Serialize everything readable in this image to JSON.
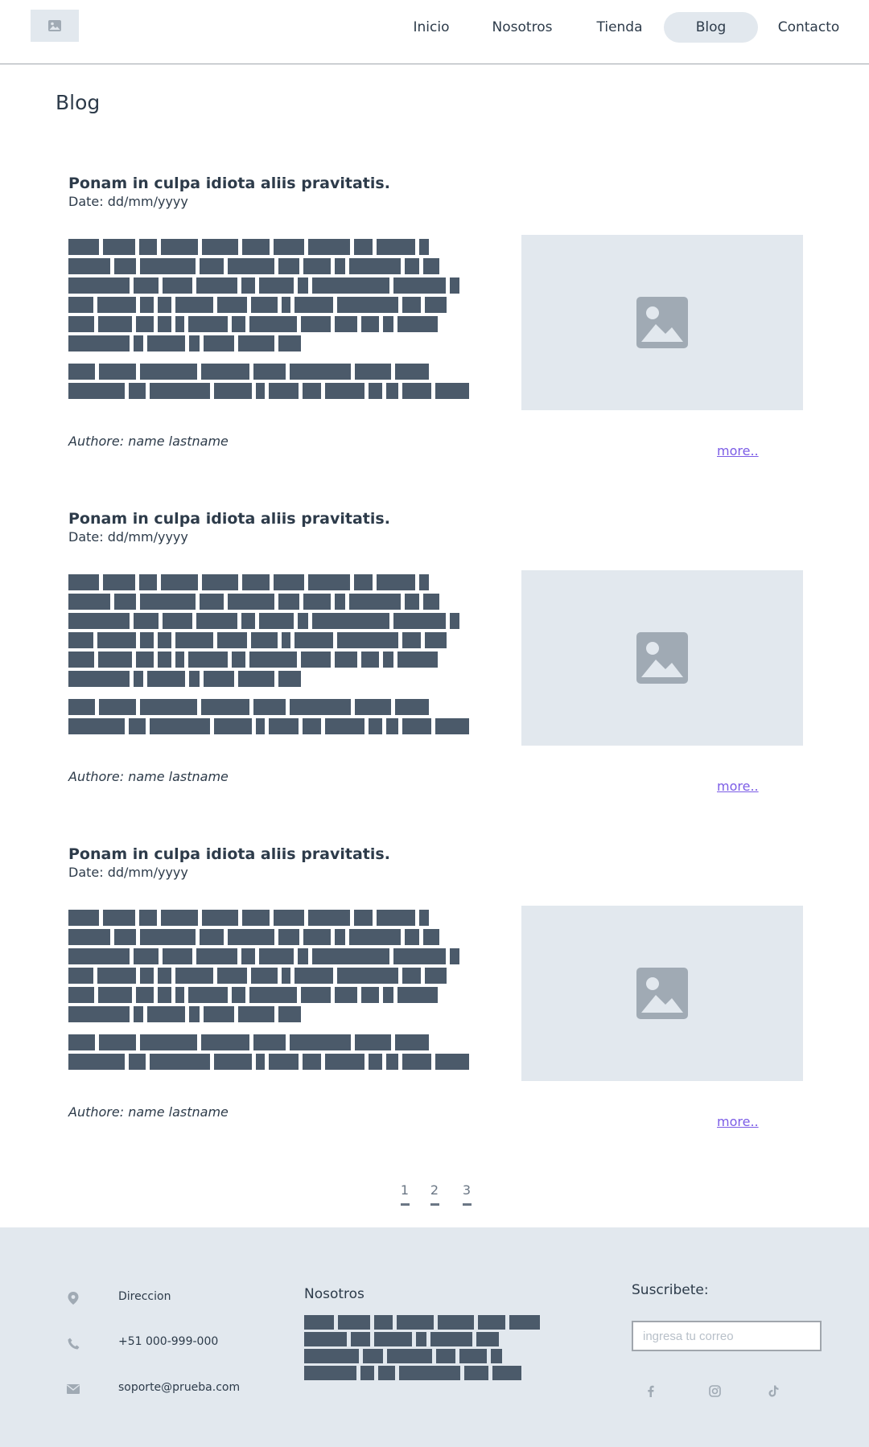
{
  "nav": {
    "items": [
      {
        "label": "Inicio",
        "active": false
      },
      {
        "label": "Nosotros",
        "active": false
      },
      {
        "label": "Tienda",
        "active": false
      },
      {
        "label": "Blog",
        "active": true
      },
      {
        "label": "Contacto",
        "active": false
      }
    ]
  },
  "page": {
    "title": "Blog"
  },
  "posts": [
    {
      "title": "Ponam in culpa idiota aliis pravitatis.",
      "date": "Date: dd/mm/yyyy",
      "author": "Authore: name lastname",
      "more_label": "more.."
    },
    {
      "title": "Ponam in culpa idiota aliis pravitatis.",
      "date": "Date: dd/mm/yyyy",
      "author": "Authore: name lastname",
      "more_label": "more.."
    },
    {
      "title": "Ponam in culpa idiota aliis pravitatis.",
      "date": "Date: dd/mm/yyyy",
      "author": "Authore: name lastname",
      "more_label": "more.."
    }
  ],
  "pagination": {
    "pages": [
      "1",
      "2",
      "3"
    ]
  },
  "footer": {
    "address_label": "Direccion",
    "phone": "+51 000-999-000",
    "email": "soporte@prueba.com",
    "about_heading": "Nosotros",
    "subscribe_heading": "Suscribete:",
    "email_placeholder": "ingresa tu correo"
  },
  "icons": {
    "logo": "image-placeholder-icon",
    "post_image": "image-placeholder-icon",
    "address": "location-pin-icon",
    "phone": "phone-icon",
    "email": "envelope-icon",
    "social": [
      "facebook-icon",
      "instagram-icon",
      "tiktok-icon"
    ]
  },
  "colors": {
    "text": "#2d3b4a",
    "placeholder_bg": "#e2e8ee",
    "placeholder_icon": "#a0aab4",
    "redacted_block": "#4b5a6a",
    "link": "#7b5ce6",
    "divider": "#a0a6ad"
  }
}
